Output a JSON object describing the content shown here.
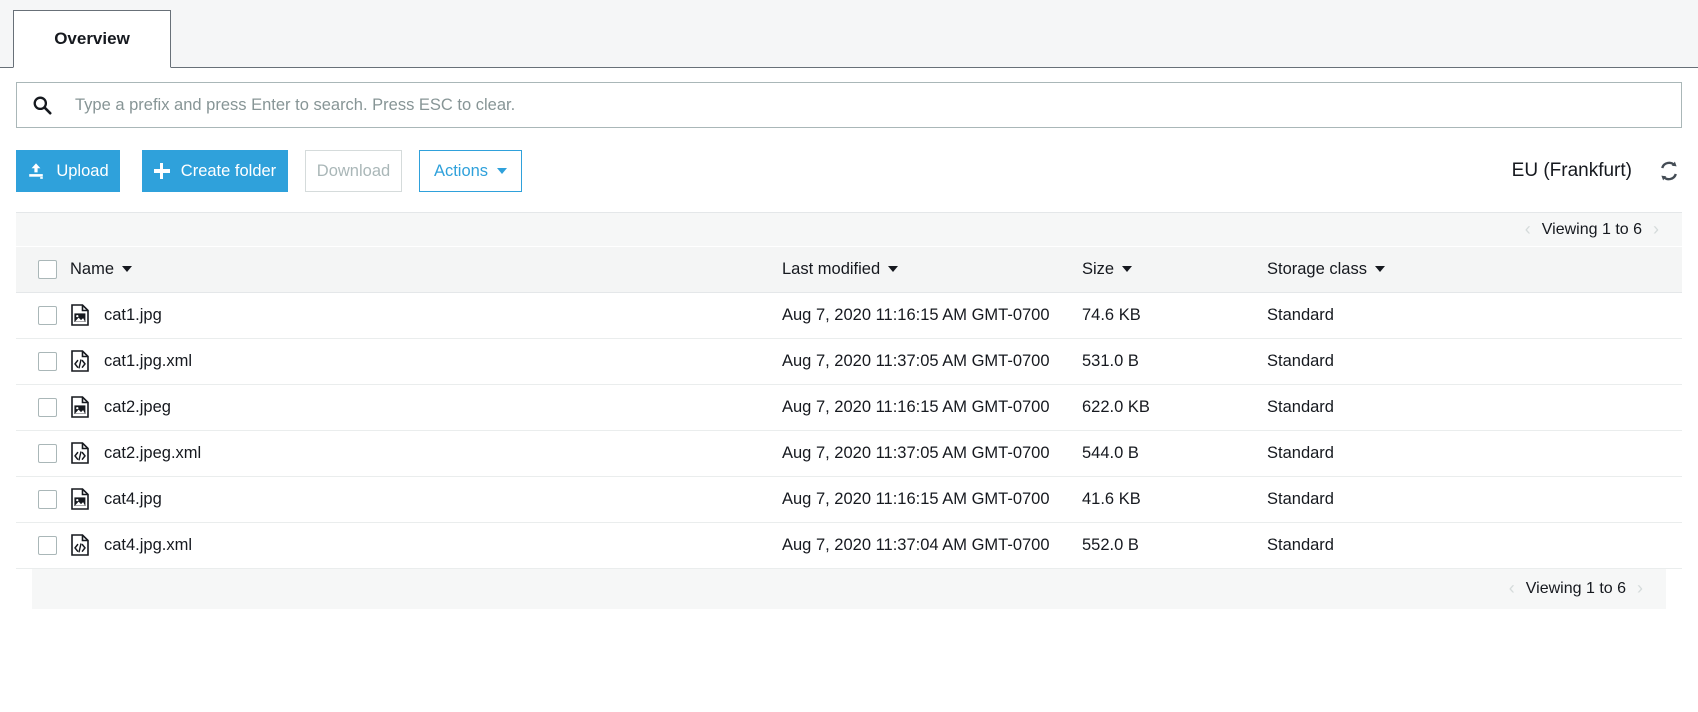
{
  "tabs": [
    {
      "label": "Overview",
      "active": true
    }
  ],
  "search": {
    "placeholder": "Type a prefix and press Enter to search. Press ESC to clear.",
    "value": "",
    "icon": "search-icon"
  },
  "toolbar": {
    "upload_label": "Upload",
    "upload_icon": "upload-icon",
    "create_folder_label": "Create folder",
    "create_folder_icon": "plus-icon",
    "download_label": "Download",
    "download_disabled": true,
    "actions_label": "Actions",
    "actions_icon": "chevron-down-icon",
    "region_label": "EU (Frankfurt)",
    "refresh_icon": "refresh-icon",
    "primary_color": "#2fa1db",
    "disabled_color": "#aab7b8"
  },
  "pagination": {
    "top_text": "Viewing 1 to 6",
    "bottom_text": "Viewing 1 to 6",
    "prev_arrow": "‹",
    "next_arrow": "›",
    "prev_enabled": false,
    "next_enabled": false
  },
  "table": {
    "columns": [
      {
        "label": "Name",
        "sortable": true
      },
      {
        "label": "Last modified",
        "sortable": true
      },
      {
        "label": "Size",
        "sortable": true
      },
      {
        "label": "Storage class",
        "sortable": true
      }
    ],
    "select_all_checked": false,
    "rows": [
      {
        "name": "cat1.jpg",
        "icon": "image-file-icon",
        "last_modified": "Aug 7, 2020 11:16:15 AM GMT-0700",
        "size": "74.6 KB",
        "storage_class": "Standard",
        "checked": false
      },
      {
        "name": "cat1.jpg.xml",
        "icon": "code-file-icon",
        "last_modified": "Aug 7, 2020 11:37:05 AM GMT-0700",
        "size": "531.0 B",
        "storage_class": "Standard",
        "checked": false
      },
      {
        "name": "cat2.jpeg",
        "icon": "image-file-icon",
        "last_modified": "Aug 7, 2020 11:16:15 AM GMT-0700",
        "size": "622.0 KB",
        "storage_class": "Standard",
        "checked": false
      },
      {
        "name": "cat2.jpeg.xml",
        "icon": "code-file-icon",
        "last_modified": "Aug 7, 2020 11:37:05 AM GMT-0700",
        "size": "544.0 B",
        "storage_class": "Standard",
        "checked": false
      },
      {
        "name": "cat4.jpg",
        "icon": "image-file-icon",
        "last_modified": "Aug 7, 2020 11:16:15 AM GMT-0700",
        "size": "41.6 KB",
        "storage_class": "Standard",
        "checked": false
      },
      {
        "name": "cat4.jpg.xml",
        "icon": "code-file-icon",
        "last_modified": "Aug 7, 2020 11:37:04 AM GMT-0700",
        "size": "552.0 B",
        "storage_class": "Standard",
        "checked": false
      }
    ]
  }
}
